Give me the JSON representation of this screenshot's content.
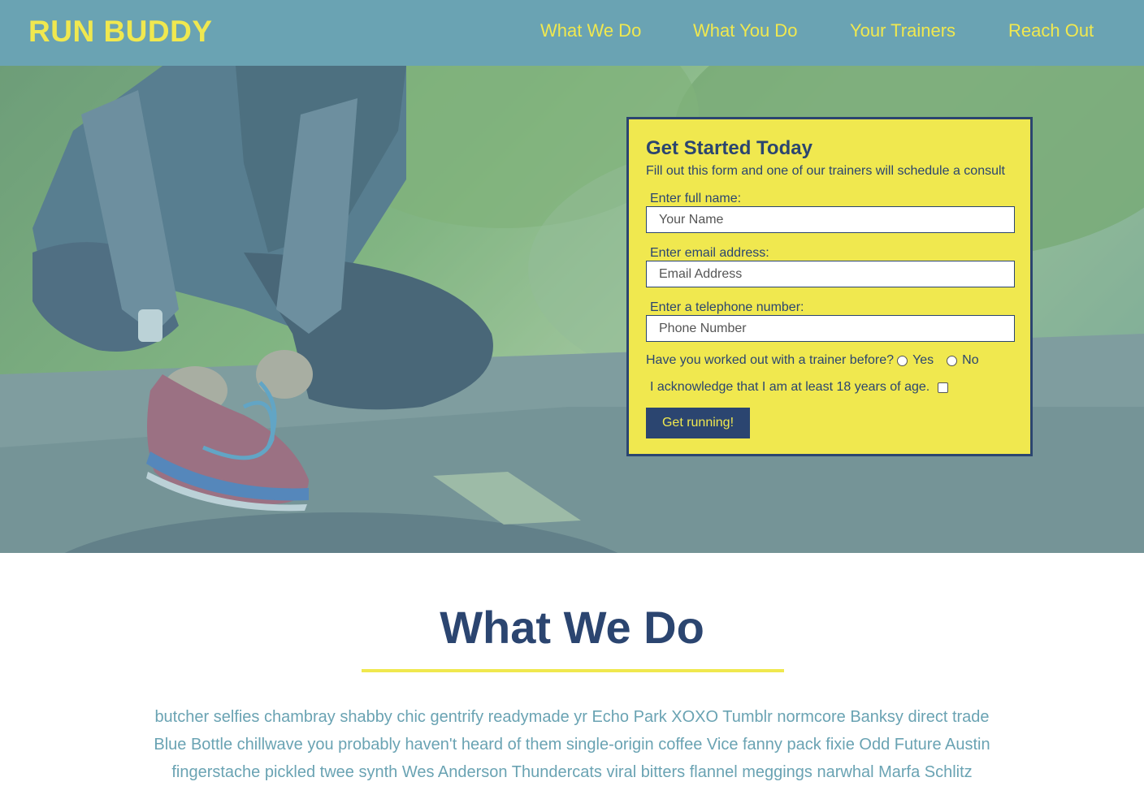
{
  "header": {
    "logo": "RUN BUDDY",
    "nav": [
      {
        "label": "What We Do"
      },
      {
        "label": "What You Do"
      },
      {
        "label": "Your Trainers"
      },
      {
        "label": "Reach Out"
      }
    ]
  },
  "form": {
    "title": "Get Started Today",
    "subtitle": "Fill out this form and one of our trainers will schedule a consult",
    "name_label": "Enter full name:",
    "name_placeholder": "Your Name",
    "email_label": "Enter email address:",
    "email_placeholder": "Email Address",
    "phone_label": "Enter a telephone number:",
    "phone_placeholder": "Phone Number",
    "trainer_question": "Have you worked out with a trainer before?",
    "yes_label": "Yes",
    "no_label": "No",
    "age_ack": "I acknowledge that I am at least 18 years of age.",
    "submit_label": "Get running!"
  },
  "section": {
    "title": "What We Do",
    "body": "butcher selfies chambray shabby chic gentrify readymade yr Echo Park XOXO Tumblr normcore Banksy direct trade Blue Bottle chillwave you probably haven't heard of them single-origin coffee Vice fanny pack fixie Odd Future Austin fingerstache pickled twee synth Wes Anderson Thundercats viral bitters flannel meggings narwhal Marfa Schlitz"
  },
  "colors": {
    "header_bg": "#6aa3b3",
    "accent_yellow": "#f0e84f",
    "navy": "#2b4570"
  }
}
